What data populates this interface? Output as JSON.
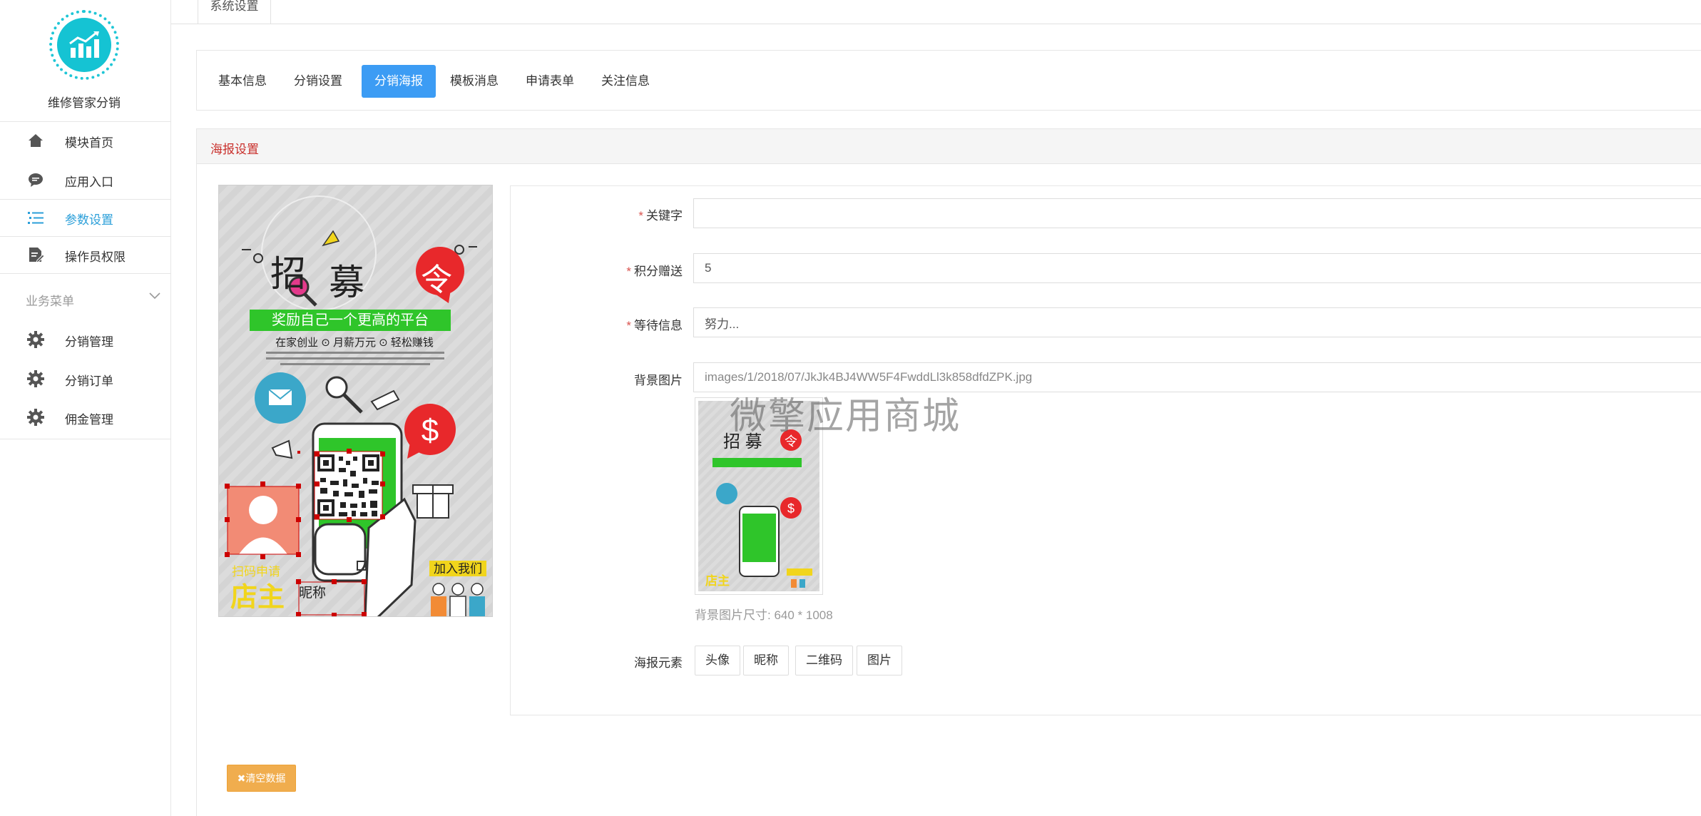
{
  "sidebar": {
    "brand_name": "维修管家分销",
    "items": [
      {
        "label": "模块首页",
        "icon": "home-icon"
      },
      {
        "label": "应用入口",
        "icon": "chat-icon"
      },
      {
        "label": "参数设置",
        "icon": "list-icon",
        "active": true
      },
      {
        "label": "操作员权限",
        "icon": "document-edit-icon"
      }
    ],
    "group_title": "业务菜单",
    "group_items": [
      {
        "label": "分销管理",
        "icon": "gear-icon"
      },
      {
        "label": "分销订单",
        "icon": "gear-icon"
      },
      {
        "label": "佣金管理",
        "icon": "gear-icon"
      }
    ]
  },
  "top_tab": "系统设置",
  "subtabs": [
    "基本信息",
    "分销设置",
    "分销海报",
    "模板消息",
    "申请表单",
    "关注信息"
  ],
  "active_subtab": "分销海报",
  "panel_title": "海报设置",
  "poster": {
    "title_chars": [
      "招",
      "募",
      "令"
    ],
    "tagline": "奖励自己一个更高的平台",
    "features": "在家创业 ⊙ 月薪万元 ⊙ 轻松赚钱",
    "join_label": "加入我们",
    "shop_owner": "店主",
    "shop_sub": "扫码申请",
    "nickname": "昵称"
  },
  "form": {
    "keyword_label": "关键字",
    "keyword_value": "",
    "points_label": "积分赠送",
    "points_value": "5",
    "wait_label": "等待信息",
    "wait_value": "努力...",
    "bg_label": "背景图片",
    "bg_value": "images/1/2018/07/JkJk4BJ4WW5F4FwddLl3k858dfdZPK.jpg",
    "bg_help": "背景图片尺寸: 640 * 1008",
    "elements_label": "海报元素",
    "elements": [
      "头像",
      "昵称",
      "二维码",
      "图片"
    ]
  },
  "watermark": "微擎应用商城",
  "clear_button": "✖清空数据",
  "colors": {
    "accent": "#3c9cf4",
    "logo": "#15c3d3",
    "panel_title": "#c9302c",
    "warning": "#f0ad4e",
    "poster_green": "#2fc52a",
    "poster_red": "#e8282b"
  }
}
